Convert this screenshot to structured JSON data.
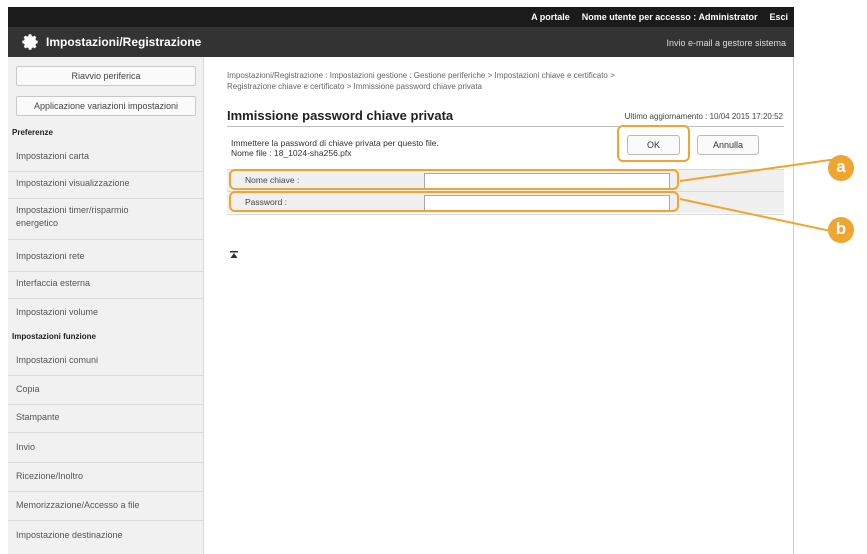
{
  "topbar": {
    "portal_link": "A portale",
    "login_user_label": "Nome utente per accesso :",
    "login_user_value": "Administrator",
    "logout_link": "Esci"
  },
  "titlebar": {
    "title": "Impostazioni/Registrazione",
    "email_admin_link": "Invio e-mail a gestore sistema"
  },
  "sidebar": {
    "restart_button": "Riavvio periferica",
    "apply_button": "Applicazione variazioni impostazioni",
    "sections": [
      {
        "heading": "Preferenze",
        "items": [
          "Impostazioni carta",
          "Impostazioni visualizzazione",
          "Impostazioni timer/risparmio energetico",
          "Impostazioni rete",
          "Interfaccia esterna",
          "Impostazioni volume"
        ]
      },
      {
        "heading": "Impostazioni funzione",
        "items": [
          "Impostazioni comuni",
          "Copia",
          "Stampante",
          "Invio",
          "Ricezione/Inoltro",
          "Memorizzazione/Accesso a file",
          "Impostazione destinazione"
        ]
      }
    ]
  },
  "main": {
    "breadcrumb_line1": "Impostazioni/Registrazione : Impostazioni gestione : Gestione periferiche > Impostazioni chiave e certificato >",
    "breadcrumb_line2": "Registrazione chiave e certificato > Immissione password chiave privata",
    "page_title": "Immissione password chiave privata",
    "last_update": "Ultimo aggiornamento : 10/04 2015 17:20:52",
    "instruction": "Immettere la password di chiave privata per questo file.",
    "file_name": "Nome file : 18_1024-sha256.pfx",
    "ok_button": "OK",
    "cancel_button": "Annulla",
    "fields": [
      {
        "label": "Nome chiave :",
        "value": ""
      },
      {
        "label": "Password :",
        "value": ""
      }
    ],
    "top_icon": "back-to-top-icon"
  },
  "callouts": [
    "a",
    "b"
  ],
  "colors": {
    "accent": "#f0a530",
    "header": "#333333",
    "topbar": "#1b1b1b"
  }
}
